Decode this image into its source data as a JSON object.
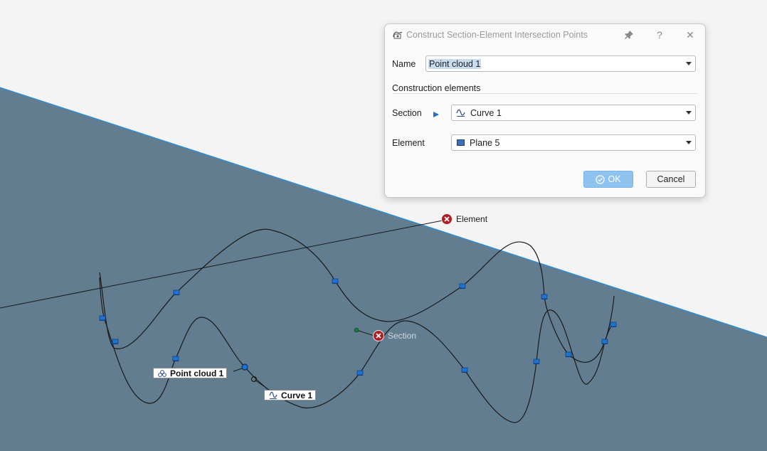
{
  "dialog": {
    "title": "Construct Section-Element Intersection Points",
    "icons": {
      "app": "section-intersection-icon",
      "pin": "pin-icon",
      "help": "help-icon",
      "close": "close-icon"
    },
    "help_glyph": "?",
    "close_glyph": "✕",
    "name_label": "Name",
    "name_value": "Point cloud 1",
    "group_label": "Construction elements",
    "section_label": "Section",
    "section_value": "Curve 1",
    "element_label": "Element",
    "element_value": "Plane 5",
    "ok_label": "OK",
    "cancel_label": "Cancel"
  },
  "viewport": {
    "plane_color": "#627d8f",
    "plane_edge_color": "#2b8fe0",
    "curve_color": "#1a1a1a",
    "point_color": "#1f73d1",
    "labels": {
      "element": "Element",
      "section": "Section",
      "point_cloud": "Point cloud 1",
      "curve": "Curve 1"
    }
  }
}
